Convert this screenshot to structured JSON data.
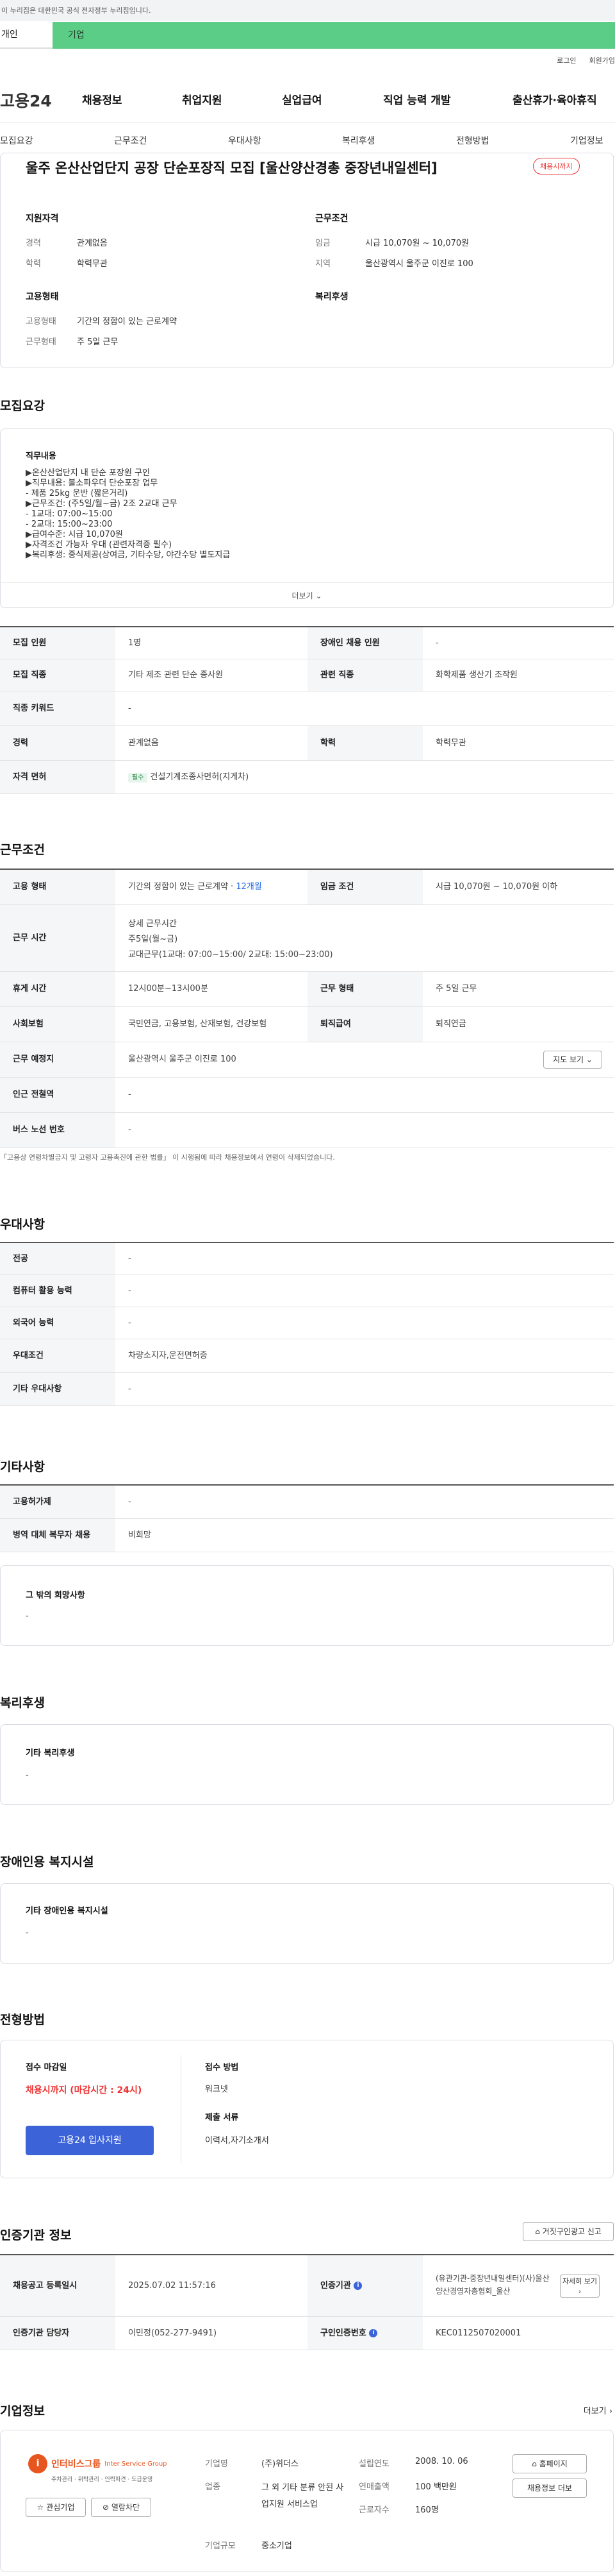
{
  "gov_banner": "이 누리집은 대한민국 공식 전자정부 누리집입니다.",
  "site_tabs": [
    "개인",
    "기업"
  ],
  "util": [
    "로그인",
    "회원가입"
  ],
  "logo": "고용24",
  "gnb": [
    "채용정보",
    "취업지원",
    "실업급여",
    "직업 능력 개발",
    "출산휴가·육아휴직"
  ],
  "subnav": [
    "모집요강",
    "근무조건",
    "우대사항",
    "복리후생",
    "전형방법",
    "기업정보"
  ],
  "job": {
    "title": "울주 온산산업단지 공장 단순포장직 모집 [울산양산경총 중장년내일센터]",
    "badge": "채용시까지",
    "qual_h": "지원자격",
    "cond_h": "근무조건",
    "emp_h": "고용형태",
    "wel_h": "복리후생",
    "k_career": "경력",
    "v_career": "관계없음",
    "k_edu": "학력",
    "v_edu": "학력무관",
    "k_wage": "임금",
    "v_wage": "시급 10,070원 ~ 10,070원",
    "k_loc": "지역",
    "v_loc": "울산광역시 울주군 이진로 100",
    "k_type": "고용형태",
    "v_type": "기간의 정함이 있는 근로계약",
    "k_work": "근무형태",
    "v_work": "주 5일 근무"
  },
  "recruit": {
    "h": "모집요강",
    "duty_h": "직무내용",
    "lines": [
      "▶온산산업단지 내 단순 포장원 구인",
      "▶직무내용: 볼소파우더 단순포장 업무",
      "- 제품 25kg 운반 (짧은거리)",
      "▶근무조건: (주5일/월~금) 2조 2교대 근무",
      "- 1교대: 07:00~15:00",
      "- 2교대: 15:00~23:00",
      "▶급여수준: 시급 10,070원",
      "▶자격조건 가능자 우대 (관련자격증 필수)",
      "▶복리후생: 중식제공(상여금, 기타수당, 야간수당 별도지급"
    ],
    "more": "더보기",
    "rows": [
      [
        "모집 인원",
        "1명",
        "장애인 채용 인원",
        "-"
      ],
      [
        "모집 직종",
        "기타 제조 관련 단순 종사원",
        "관련 직종",
        "화학제품 생산기 조작원"
      ],
      [
        "직종 키워드",
        "-"
      ],
      [
        "경력",
        "관계없음",
        "학력",
        "학력무관"
      ],
      [
        "자격 면허",
        "필수",
        "건설기계조종사면허(지게차)"
      ]
    ]
  },
  "cond": {
    "h": "근무조건",
    "type_k": "고용 형태",
    "type_v": "기간의 정함이 있는 근로계약 · ",
    "type_link": "12개월",
    "wage_k": "임금 조건",
    "wage_v": "시급 10,070원 ~ 10,070원 이하",
    "time_k": "근무 시간",
    "time_h": "상세 근무시간",
    "time_1": "주5일(월~금)",
    "time_2": "교대근무(1교대: 07:00~15:00/ 2교대: 15:00~23:00)",
    "rest_k": "휴게 시간",
    "rest_v": "12시00분~13시00분",
    "form_k": "근무 형태",
    "form_v": "주 5일 근무",
    "ins_k": "사회보험",
    "ins_v": "국민연금, 고용보험, 산재보험, 건강보험",
    "ret_k": "퇴직급여",
    "ret_v": "퇴직연금",
    "place_k": "근무 예정지",
    "place_v": "울산광역시 울주군 이진로 100",
    "map": "지도 보기",
    "sub_k": "인근 전철역",
    "sub_v": "-",
    "bus_k": "버스 노선 번호",
    "bus_v": "-",
    "note": "「고용상 연령차별금지 및 고령자 고용촉진에 관한 법률」 이 시행됨에 따라 채용정보에서 연령이 삭제되었습니다."
  },
  "pref": {
    "h": "우대사항",
    "rows": [
      [
        "전공",
        "-"
      ],
      [
        "컴퓨터 활용 능력",
        "-"
      ],
      [
        "외국어 능력",
        "-"
      ],
      [
        "우대조건",
        "차량소지자,운전면허증"
      ],
      [
        "기타 우대사항",
        "-"
      ]
    ]
  },
  "etc": {
    "h": "기타사항",
    "rows": [
      [
        "고용허가제",
        "-"
      ],
      [
        "병역 대체 복무자 채용",
        "비희망"
      ]
    ],
    "wish_h": "그 밖의 희망사항",
    "wish_v": "-"
  },
  "welfare": {
    "h": "복리후생",
    "box_h": "기타 복리후생",
    "box_v": "-"
  },
  "dis": {
    "h": "장애인용 복지시설",
    "box_h": "기타 장애인용 복지시설",
    "box_v": "-"
  },
  "sel": {
    "h": "전형방법",
    "dl_h": "접수 마감일",
    "dl_v": "채용시까지 (마감시간 : 24시)",
    "apply": "고용24 입사지원",
    "method_h": "접수 방법",
    "method_v": "워크넷",
    "docs_h": "제출 서류",
    "docs_v": "이력서,자기소개서"
  },
  "cert": {
    "h": "인증기관 정보",
    "report": "거짓구인광고 신고",
    "reg_k": "채용공고 등록일시",
    "reg_v": "2025.07.02 11:57:16",
    "org_k": "인증기관",
    "org_v": "(유관기관-중장년내일센터)(사)울산양산경영자총협회_울산",
    "more": "자세히 보기",
    "mgr_k": "인증기관 담당자",
    "mgr_v": "이민정(052-277-9491)",
    "no_k": "구인인증번호",
    "no_v": "KEC0112507020001"
  },
  "comp": {
    "h": "기업정보",
    "more": "더보기",
    "logo_a": "인터비스그룹",
    "logo_b": "Inter Service Group",
    "logo_c": "주차관리 · 위탁관리 · 인력파견 · 도급운영",
    "fav": "관심기업",
    "block": "열람차단",
    "k_name": "기업명",
    "v_name": "(주)위더스",
    "k_ind": "업종",
    "v_ind": "그 외 기타 분류 안된 사업지원 서비스업",
    "k_size": "기업규모",
    "v_size": "중소기업",
    "k_est": "설립연도",
    "v_est": "2008. 10. 06",
    "k_sales": "연매출액",
    "v_sales": "100 백만원",
    "k_emp": "근로자수",
    "v_emp": "160명",
    "home": "홈페이지",
    "other": "채용정보 더보"
  },
  "colors": {
    "green": "#5ccd86",
    "blue_btn": "#3d63d9",
    "red": "#e33333"
  }
}
